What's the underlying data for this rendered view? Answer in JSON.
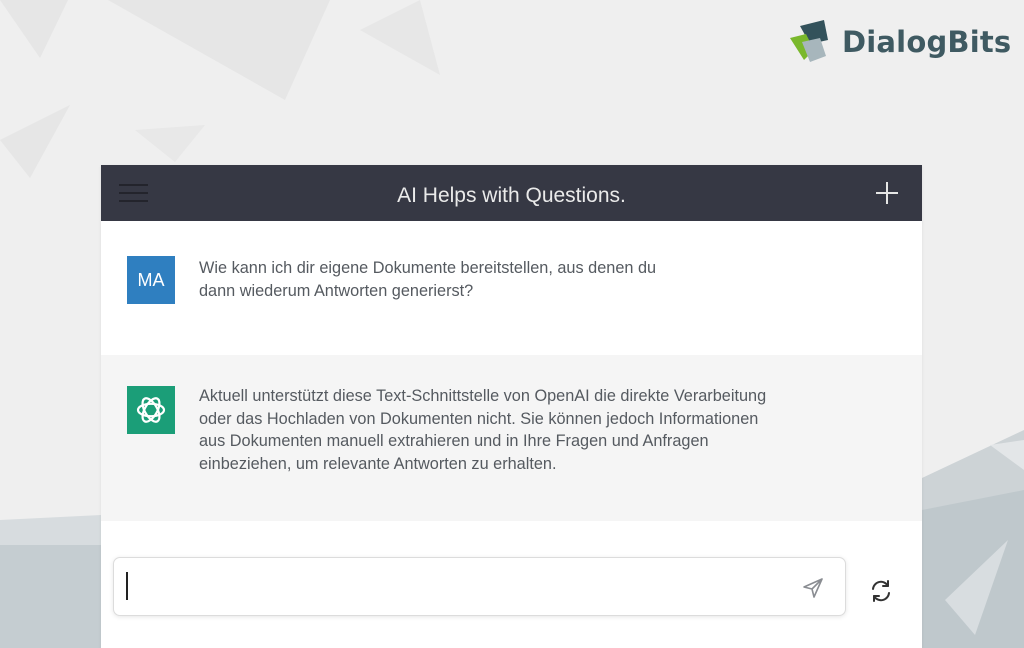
{
  "brand": {
    "name": "DialogBits",
    "logo_icon": "dialogbits-logo-icon"
  },
  "chat": {
    "title": "AI Helps with Questions.",
    "menu_icon": "hamburger-menu-icon",
    "new_chat_icon": "plus-icon",
    "messages": [
      {
        "role": "user",
        "avatar_text": "MA",
        "lines": [
          "Wie kann ich dir eigene Dokumente bereitstellen, aus denen du",
          "dann wiederum Antworten generierst?"
        ]
      },
      {
        "role": "assistant",
        "avatar_icon": "openai-logo-icon",
        "lines": [
          "Aktuell unterstützt diese Text-Schnittstelle von OpenAI die direkte Verarbeitung",
          "oder das Hochladen von Dokumenten nicht. Sie können jedoch Informationen",
          "aus Dokumenten manuell extrahieren und in Ihre Fragen und Anfragen",
          "einbeziehen, um relevante Antworten zu erhalten."
        ]
      }
    ],
    "input": {
      "value": "",
      "placeholder": ""
    },
    "send_icon": "send-icon",
    "refresh_icon": "refresh-icon"
  },
  "colors": {
    "header_bg": "#363844",
    "user_avatar": "#2f7fc0",
    "assistant_avatar": "#1b9e78",
    "assistant_row_bg": "#f5f5f5",
    "brand_text": "#3f5a62"
  }
}
